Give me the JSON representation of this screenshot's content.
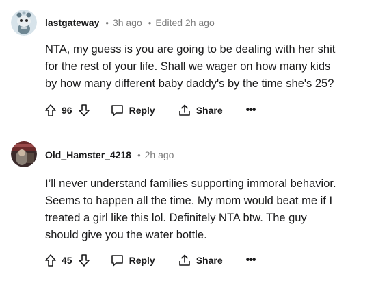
{
  "comments": [
    {
      "username": "lastgateway",
      "time": "3h ago",
      "edited": "Edited 2h ago",
      "avatar_icon": "snoo-avatar-icon",
      "lines": [
        "NTA, my guess is you are going to be dealing with her shit",
        "for the rest of your life. Shall we wager on how many kids",
        "by how many different baby daddy's by the time she's 25?"
      ],
      "votes": "96",
      "reply_label": "Reply",
      "share_label": "Share",
      "more_label": "•••"
    },
    {
      "username": "Old_Hamster_4218",
      "time": "2h ago",
      "avatar_icon": "photo-avatar-icon",
      "lines": [
        "I’ll never understand families supporting immoral behavior.",
        "Seems to happen all the time. My mom would beat me if I",
        "treated a girl like this lol. Definitely NTA btw. The guy",
        "should give you the water bottle."
      ],
      "votes": "45",
      "reply_label": "Reply",
      "share_label": "Share",
      "more_label": "•••"
    }
  ],
  "colors": {
    "text": "#1a1a1b",
    "muted": "#7c7c7c",
    "background": "#ffffff"
  }
}
